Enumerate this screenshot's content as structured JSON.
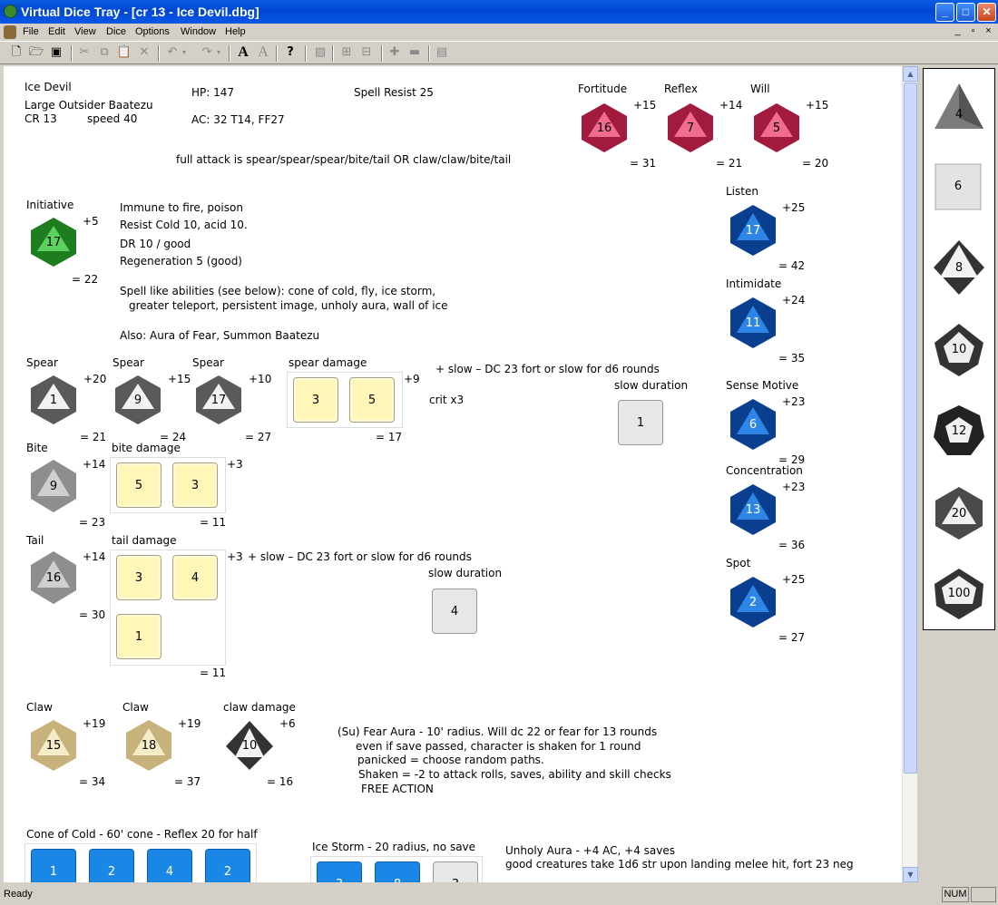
{
  "window": {
    "title": "Virtual Dice Tray - [cr 13 - Ice Devil.dbg]"
  },
  "menu": [
    "File",
    "Edit",
    "View",
    "Dice",
    "Options",
    "Window",
    "Help"
  ],
  "status": {
    "text": "Ready",
    "num": "NUM"
  },
  "stats": {
    "name": "Ice Devil",
    "type": "Large Outsider Baatezu",
    "cr": "CR 13",
    "speed": "speed 40",
    "hp": "HP:  147",
    "ac": "AC: 32    T14, FF27",
    "sr": "Spell Resist 25",
    "full_attack": "full attack is spear/spear/spear/bite/tail  OR claw/claw/bite/tail",
    "abilities": [
      "Immune to fire, poison",
      "Resist Cold 10, acid 10.",
      "DR 10 / good",
      "Regeneration 5 (good)"
    ],
    "spell_like1": "Spell like abilities (see below): cone of cold, fly, ice storm,",
    "spell_like2": "greater teleport, persistent image, unholy aura, wall of ice",
    "also": "Also: Aura of Fear, Summon Baatezu",
    "slow1": "+ slow – DC 23 fort or slow for d6 rounds",
    "crit": "crit x3",
    "slow2": "+ slow – DC 23 fort or slow for d6 rounds",
    "fear": [
      "(Su) Fear Aura - 10' radius. Will dc 22 or fear for 13 rounds",
      "even if save passed, character is shaken for 1 round",
      "panicked = choose random paths.",
      "Shaken = -2 to attack rolls, saves, ability and skill checks",
      "FREE ACTION"
    ],
    "cone": "Cone of Cold - 60' cone - Reflex 20 for half",
    "ice_storm": "Ice Storm - 20 radius, no save",
    "unholy1": "Unholy Aura - +4 AC, +4 saves",
    "unholy2": "good creatures take 1d6 str upon landing melee hit, fort 23 neg"
  },
  "saves": [
    {
      "label": "Fortitude",
      "roll": "16",
      "mod": "+15",
      "total": "= 31"
    },
    {
      "label": "Reflex",
      "roll": "7",
      "mod": "+14",
      "total": "= 21"
    },
    {
      "label": "Will",
      "roll": "5",
      "mod": "+15",
      "total": "= 20"
    }
  ],
  "initiative": {
    "label": "Initiative",
    "roll": "17",
    "mod": "+5",
    "total": "= 22"
  },
  "skills": [
    {
      "label": "Listen",
      "roll": "17",
      "mod": "+25",
      "total": "= 42"
    },
    {
      "label": "Intimidate",
      "roll": "11",
      "mod": "+24",
      "total": "= 35"
    },
    {
      "label": "Sense Motive",
      "roll": "6",
      "mod": "+23",
      "total": "= 29"
    },
    {
      "label": "Concentration",
      "roll": "13",
      "mod": "+23",
      "total": "= 36"
    },
    {
      "label": "Spot",
      "roll": "2",
      "mod": "+25",
      "total": "= 27"
    }
  ],
  "spears": [
    {
      "label": "Spear",
      "roll": "1",
      "mod": "+20",
      "total": "= 21"
    },
    {
      "label": "Spear",
      "roll": "9",
      "mod": "+15",
      "total": "= 24"
    },
    {
      "label": "Spear",
      "roll": "17",
      "mod": "+10",
      "total": "= 27"
    }
  ],
  "spear_damage": {
    "label": "spear damage",
    "dice": [
      "3",
      "5"
    ],
    "mod": "+9",
    "total": "= 17"
  },
  "slow_duration1": {
    "label": "slow duration",
    "value": "1"
  },
  "bite": {
    "label": "Bite",
    "roll": "9",
    "mod": "+14",
    "total": "= 23"
  },
  "bite_damage": {
    "label": "bite damage",
    "dice": [
      "5",
      "3"
    ],
    "mod": "+3",
    "total": "= 11"
  },
  "tail": {
    "label": "Tail",
    "roll": "16",
    "mod": "+14",
    "total": "= 30"
  },
  "tail_damage": {
    "label": "tail damage",
    "dice": [
      "3",
      "4",
      "1"
    ],
    "mod": "+3",
    "total": "= 11"
  },
  "slow_duration2": {
    "label": "slow duration",
    "value": "4"
  },
  "claws": [
    {
      "label": "Claw",
      "roll": "15",
      "mod": "+19",
      "total": "= 34"
    },
    {
      "label": "Claw",
      "roll": "18",
      "mod": "+19",
      "total": "= 37"
    }
  ],
  "claw_damage": {
    "label": "claw damage",
    "roll": "10",
    "mod": "+6",
    "total": "= 16"
  },
  "cone_dice": [
    "1",
    "2",
    "4",
    "2"
  ],
  "ice_dice": [
    "3",
    "8",
    "3"
  ],
  "tray": [
    "4",
    "6",
    "8",
    "10",
    "12",
    "20",
    "100"
  ]
}
